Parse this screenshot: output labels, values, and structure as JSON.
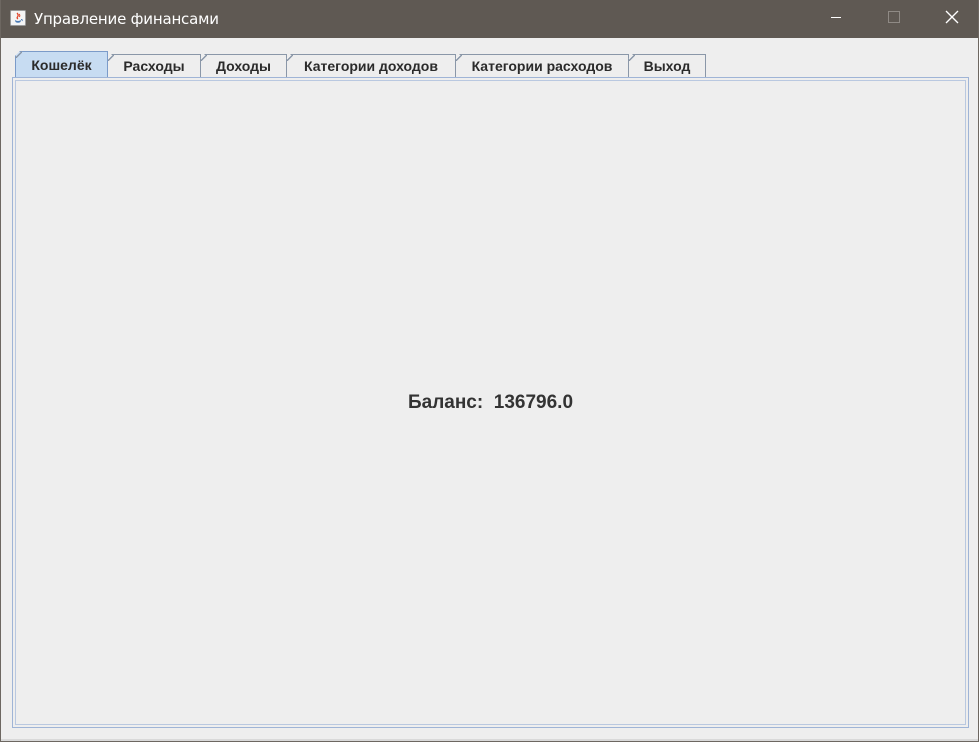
{
  "window": {
    "title": "Управление финансами",
    "titlebar_color": "#5f5953",
    "app_icon": "java-icon",
    "controls": {
      "minimize": "minimize-icon",
      "maximize": "maximize-icon",
      "close": "close-icon"
    }
  },
  "tabs": [
    {
      "label": "Кошелёк",
      "active": true
    },
    {
      "label": "Расходы",
      "active": false
    },
    {
      "label": "Доходы",
      "active": false
    },
    {
      "label": "Категории доходов",
      "active": false
    },
    {
      "label": "Категории расходов",
      "active": false
    },
    {
      "label": "Выход",
      "active": false
    }
  ],
  "wallet": {
    "balance_label": "Баланс:",
    "balance_value": "136796.0"
  },
  "colors": {
    "active_tab": "#c7dcf2",
    "tab_border": "#8a97a8",
    "panel_border": "#9fb4d6",
    "background": "#eeeeee"
  }
}
